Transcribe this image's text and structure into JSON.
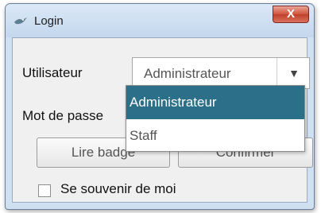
{
  "window": {
    "title": "Login",
    "close_glyph": "X"
  },
  "form": {
    "user_label": "Utilisateur",
    "password_label": "Mot de passe",
    "user_value": "Administrateur",
    "badge_button": "Lire badge",
    "confirm_button": "Confirmer",
    "remember_label": "Se souvenir de moi"
  },
  "dropdown": {
    "options": [
      "Administrateur",
      "Staff"
    ],
    "selected_index": 0
  },
  "colors": {
    "selection": "#2b7088",
    "title_bar": "#cfe0f2",
    "close_button": "#c94a34"
  },
  "icons": {
    "app": "bird-icon",
    "combo_arrow": "chevron-down-icon"
  }
}
